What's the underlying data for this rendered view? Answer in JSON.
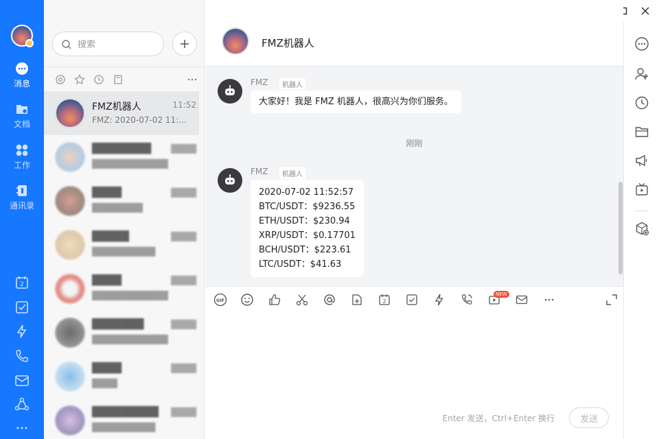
{
  "nav": {
    "items": [
      {
        "label": "消息",
        "icon": "chat-bubble-icon"
      },
      {
        "label": "文档",
        "icon": "folder-icon"
      },
      {
        "label": "工作",
        "icon": "apps-icon"
      },
      {
        "label": "通讯录",
        "icon": "contacts-icon"
      }
    ],
    "tools": [
      "calendar-icon",
      "checkbox-icon",
      "lightning-icon",
      "phone-icon",
      "mail-icon",
      "share-icon",
      "more-icon"
    ],
    "calendar_day": "2"
  },
  "search": {
    "placeholder": "搜索"
  },
  "conversations": [
    {
      "name": "FMZ机器人",
      "time": "11:52",
      "preview": "FMZ: 2020-07-02 11:...",
      "active": true
    },
    {
      "name": "████████",
      "time": "████",
      "preview": "████████████",
      "active": false
    },
    {
      "name": "████",
      "time": "████",
      "preview": "████████",
      "active": false
    },
    {
      "name": "█████",
      "time": "████",
      "preview": "██████████",
      "active": false
    },
    {
      "name": "████",
      "time": "████",
      "preview": "████████████",
      "active": false
    },
    {
      "name": "███████",
      "time": "████",
      "preview": "████████████",
      "active": false
    },
    {
      "name": "████",
      "time": "████",
      "preview": "████",
      "active": false
    },
    {
      "name": "█████████",
      "time": "████",
      "preview": "██████████",
      "active": false
    }
  ],
  "chat": {
    "title": "FMZ机器人",
    "messages": [
      {
        "sender": "FMZ",
        "tag": "机器人",
        "lines": [
          "大家好！我是 FMZ 机器人，很高兴为你们服务。"
        ]
      },
      {
        "sender": "FMZ",
        "tag": "机器人",
        "lines": [
          "2020-07-02 11:52:57",
          "BTC/USDT：$9236.55",
          "ETH/USDT：$230.94",
          "XRP/USDT：$0.17701",
          "BCH/USDT：$223.61",
          "LTC/USDT：$41.63"
        ]
      }
    ],
    "time_divider": "刚刚",
    "new_badge": "NEW",
    "gif_label": "GIF",
    "calendar_day": "2",
    "hint": "Enter 发送，Ctrl+Enter 换行",
    "send_label": "发送"
  },
  "colors": {
    "brand": "#1677ff",
    "list_bg": "#f7f7f8",
    "messages_bg": "#f3f4f6"
  }
}
